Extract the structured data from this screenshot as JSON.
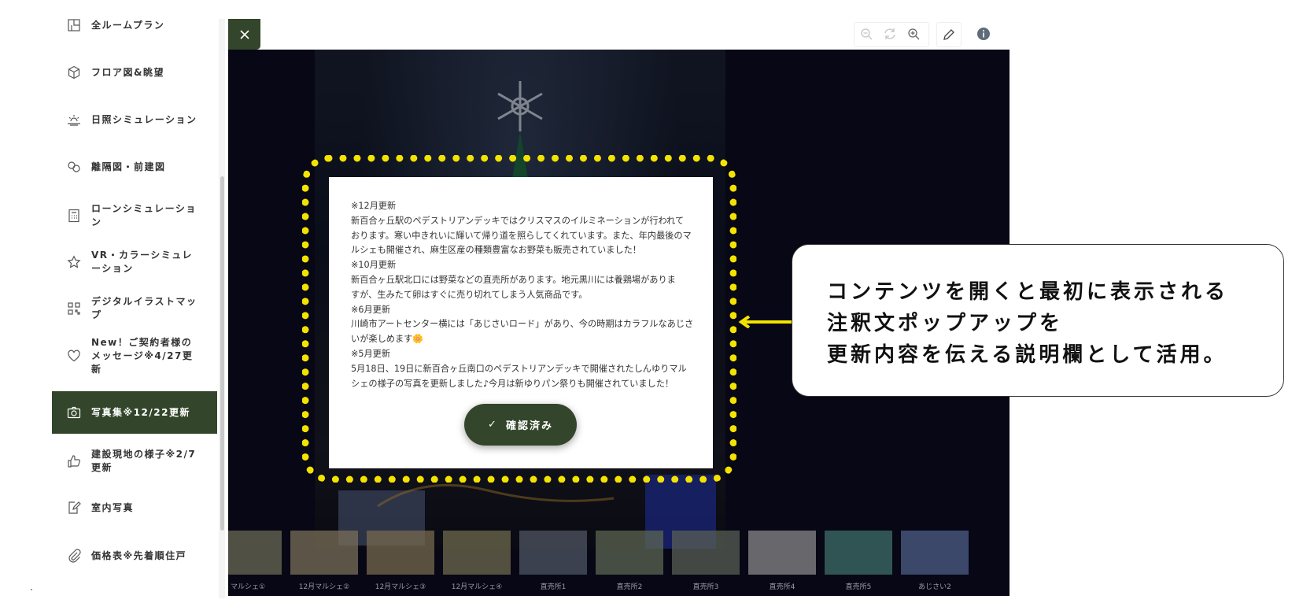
{
  "sidebar": {
    "items": [
      {
        "label": "全ルームプラン",
        "icon": "floorplan-icon"
      },
      {
        "label": "フロア図&眺望",
        "icon": "cube-icon"
      },
      {
        "label": "日照シミュレーション",
        "icon": "sunrise-icon"
      },
      {
        "label": "離隔図・前建図",
        "icon": "buildings-icon"
      },
      {
        "label": "ローンシミュレーション",
        "icon": "calculator-icon"
      },
      {
        "label": "VR・カラーシミュレーション",
        "icon": "star-icon"
      },
      {
        "label": "デジタルイラストマップ",
        "icon": "qr-icon"
      },
      {
        "label": "New！ご契約者様のメッセージ※4/27更新",
        "icon": "heart-icon"
      },
      {
        "label": "写真集※12/22更新",
        "icon": "camera-icon",
        "active": true
      },
      {
        "label": "建設現地の様子※2/7更新",
        "icon": "thumbs-up-icon"
      },
      {
        "label": "室内写真",
        "icon": "edit-note-icon"
      },
      {
        "label": "価格表※先着順住戸",
        "icon": "paperclip-icon"
      }
    ]
  },
  "viewer": {
    "toolbar_icons": [
      "zoom-out-icon",
      "reset-icon",
      "zoom-in-icon",
      "pen-icon",
      "info-icon"
    ],
    "thumbnails": [
      {
        "label": "マルシェ①",
        "color": "#6b6a55"
      },
      {
        "label": "12月マルシェ②",
        "color": "#7a6f58"
      },
      {
        "label": "12月マルシェ③",
        "color": "#756a4d"
      },
      {
        "label": "12月マルシェ④",
        "color": "#6d6a4e"
      },
      {
        "label": "直売所1",
        "color": "#4f5663"
      },
      {
        "label": "直売所2",
        "color": "#5c6552"
      },
      {
        "label": "直売所3",
        "color": "#5a5f55"
      },
      {
        "label": "直売所4",
        "color": "#8a8a8a"
      },
      {
        "label": "直売所5",
        "color": "#3f6f6a"
      },
      {
        "label": "あじさい2",
        "color": "#4d5f86"
      }
    ]
  },
  "modal": {
    "text": "※12月更新\n新百合ヶ丘駅のペデストリアンデッキではクリスマスのイルミネーションが行われて\nおります。寒い中きれいに輝いて帰り道を照らしてくれています。また、年内最後のマ\nルシェも開催され、麻生区産の種類豊富なお野菜も販売されていました！\n※10月更新\n新百合ヶ丘駅北口には野菜などの直売所があります。地元黒川には養鶏場がありま\nすが、生みたて卵はすぐに売り切れてしまう人気商品です。\n※6月更新\n川崎市アートセンター横には「あじさいロード」があり、今の時期はカラフルなあじさ\nいが楽しめます🌼\n※5月更新\n5月18日、19日に新百合ヶ丘南口のペデストリアンデッキで開催されたしんゆりマル\nシェの様子の写真を更新しました♪今月は新ゆりパン祭りも開催されていました！",
    "confirm_label": "確認済み"
  },
  "callout": {
    "lines": [
      "コンテンツを開くと最初に表示される",
      "注釈文ポップアップを",
      "更新内容を伝える説明欄として活用。"
    ]
  },
  "colors": {
    "accent": "#33462b",
    "highlight": "#f4e300",
    "viewer_bg": "#0b0b1c"
  }
}
